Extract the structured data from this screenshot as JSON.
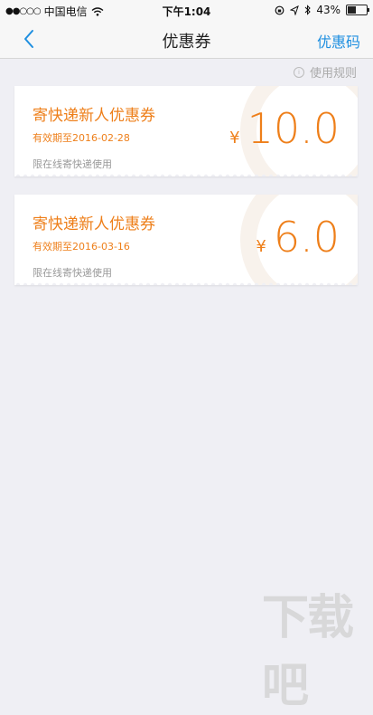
{
  "status_bar": {
    "signal": "●●○○○",
    "carrier": "中国电信",
    "time": "下午1:04",
    "battery": "43%"
  },
  "nav": {
    "back_icon": "chevron-left-icon",
    "title": "优惠券",
    "right_label": "优惠码"
  },
  "rules_link": "使用规则",
  "coupons": [
    {
      "name": "寄快递新人优惠券",
      "expiry": "有效期至2016-02-28",
      "scope": "限在线寄快递使用",
      "currency": "¥",
      "amount": "10.0"
    },
    {
      "name": "寄快递新人优惠券",
      "expiry": "有效期至2016-03-16",
      "scope": "限在线寄快递使用",
      "currency": "¥",
      "amount": "6.0"
    }
  ],
  "watermark": {
    "logo": "下载吧"
  },
  "colors": {
    "accent": "#ee7f1a",
    "nav_link": "#1e8fe0",
    "background": "#efeff4"
  }
}
